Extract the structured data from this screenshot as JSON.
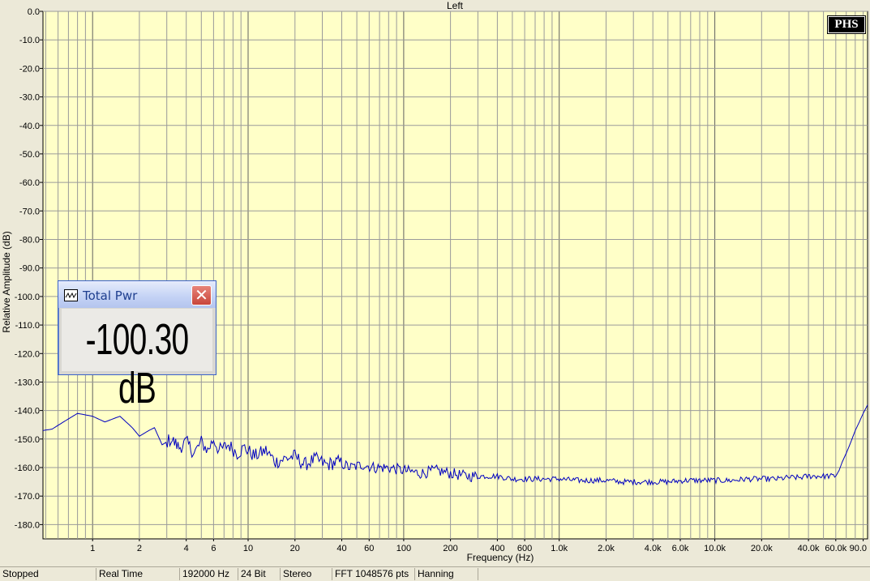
{
  "chart_data": {
    "type": "line",
    "title": "Left",
    "xlabel": "Frequency (Hz)",
    "ylabel": "Relative Amplitude (dB)",
    "x_scale": "log",
    "xlim": [
      0.48,
      96000
    ],
    "ylim": [
      -185,
      0
    ],
    "grid": true,
    "y_ticks": [
      0,
      -10,
      -20,
      -30,
      -40,
      -50,
      -60,
      -70,
      -80,
      -90,
      -100,
      -110,
      -120,
      -130,
      -140,
      -150,
      -160,
      -170,
      -180
    ],
    "y_tick_labels": [
      "0.0",
      "-10.0",
      "-20.0",
      "-30.0",
      "-40.0",
      "-50.0",
      "-60.0",
      "-70.0",
      "-80.0",
      "-90.0",
      "-100.0",
      "-110.0",
      "-120.0",
      "-130.0",
      "-140.0",
      "-150.0",
      "-160.0",
      "-170.0",
      "-180.0"
    ],
    "x_ticks": [
      1,
      2,
      4,
      6,
      10,
      20,
      40,
      60,
      100,
      200,
      400,
      600,
      1000,
      2000,
      4000,
      6000,
      10000,
      20000,
      40000,
      60000,
      90000
    ],
    "x_tick_labels": [
      "1",
      "2",
      "4",
      "6",
      "10",
      "20",
      "40",
      "60",
      "100",
      "200",
      "400",
      "600",
      "1.0k",
      "2.0k",
      "4.0k",
      "6.0k",
      "10.0k",
      "20.0k",
      "40.0k",
      "60.0k",
      "90.0"
    ],
    "series": [
      {
        "color": "#0000c0",
        "x": [
          0.48,
          0.55,
          0.65,
          0.8,
          1.0,
          1.2,
          1.5,
          1.8,
          2.0,
          2.3,
          2.5,
          2.8,
          3.2,
          3.6,
          4.0,
          4.5,
          5.0,
          5.5,
          6.0,
          6.5,
          7.5,
          8.5,
          9.5,
          11,
          13,
          15,
          17,
          20,
          23,
          27,
          32,
          38,
          45,
          55,
          65,
          80,
          100,
          130,
          160,
          200,
          250,
          320,
          400,
          500,
          650,
          800,
          1000,
          1300,
          1600,
          2000,
          2500,
          3200,
          4000,
          5000,
          6500,
          8000,
          10000,
          13000,
          16000,
          20000,
          25000,
          30000,
          35000,
          40000,
          45000,
          50000,
          55000,
          60000,
          63000,
          66000,
          70000,
          75000,
          80000,
          85000,
          90000,
          96000
        ],
        "y": [
          -147,
          -146.5,
          -144,
          -141,
          -142,
          -144,
          -142,
          -146,
          -149,
          -147,
          -146,
          -152,
          -150,
          -153,
          -151,
          -155,
          -151,
          -154,
          -150,
          -154,
          -152,
          -155,
          -153,
          -156,
          -154,
          -158,
          -157,
          -156,
          -159,
          -157,
          -159,
          -158,
          -160,
          -159,
          -160,
          -160,
          -161,
          -162,
          -161,
          -162,
          -163,
          -163,
          -163,
          -164,
          -164,
          -164,
          -164,
          -164.5,
          -164.5,
          -164.5,
          -165,
          -165,
          -165,
          -165,
          -164.5,
          -164.5,
          -164.5,
          -164.5,
          -164,
          -164,
          -164,
          -163.5,
          -163.5,
          -163,
          -163,
          -163,
          -163,
          -163,
          -161,
          -158,
          -155,
          -151,
          -147,
          -144,
          -141,
          -138
        ]
      }
    ]
  },
  "popup": {
    "title": "Total Pwr",
    "value": "-100.30 dB",
    "close_glyph": "✕"
  },
  "logo": {
    "text": "PHS"
  },
  "statusbar": {
    "cells": [
      "Stopped",
      "Real Time",
      "192000 Hz",
      "24 Bit",
      "Stereo",
      "FFT 1048576 pts",
      "Hanning"
    ]
  }
}
